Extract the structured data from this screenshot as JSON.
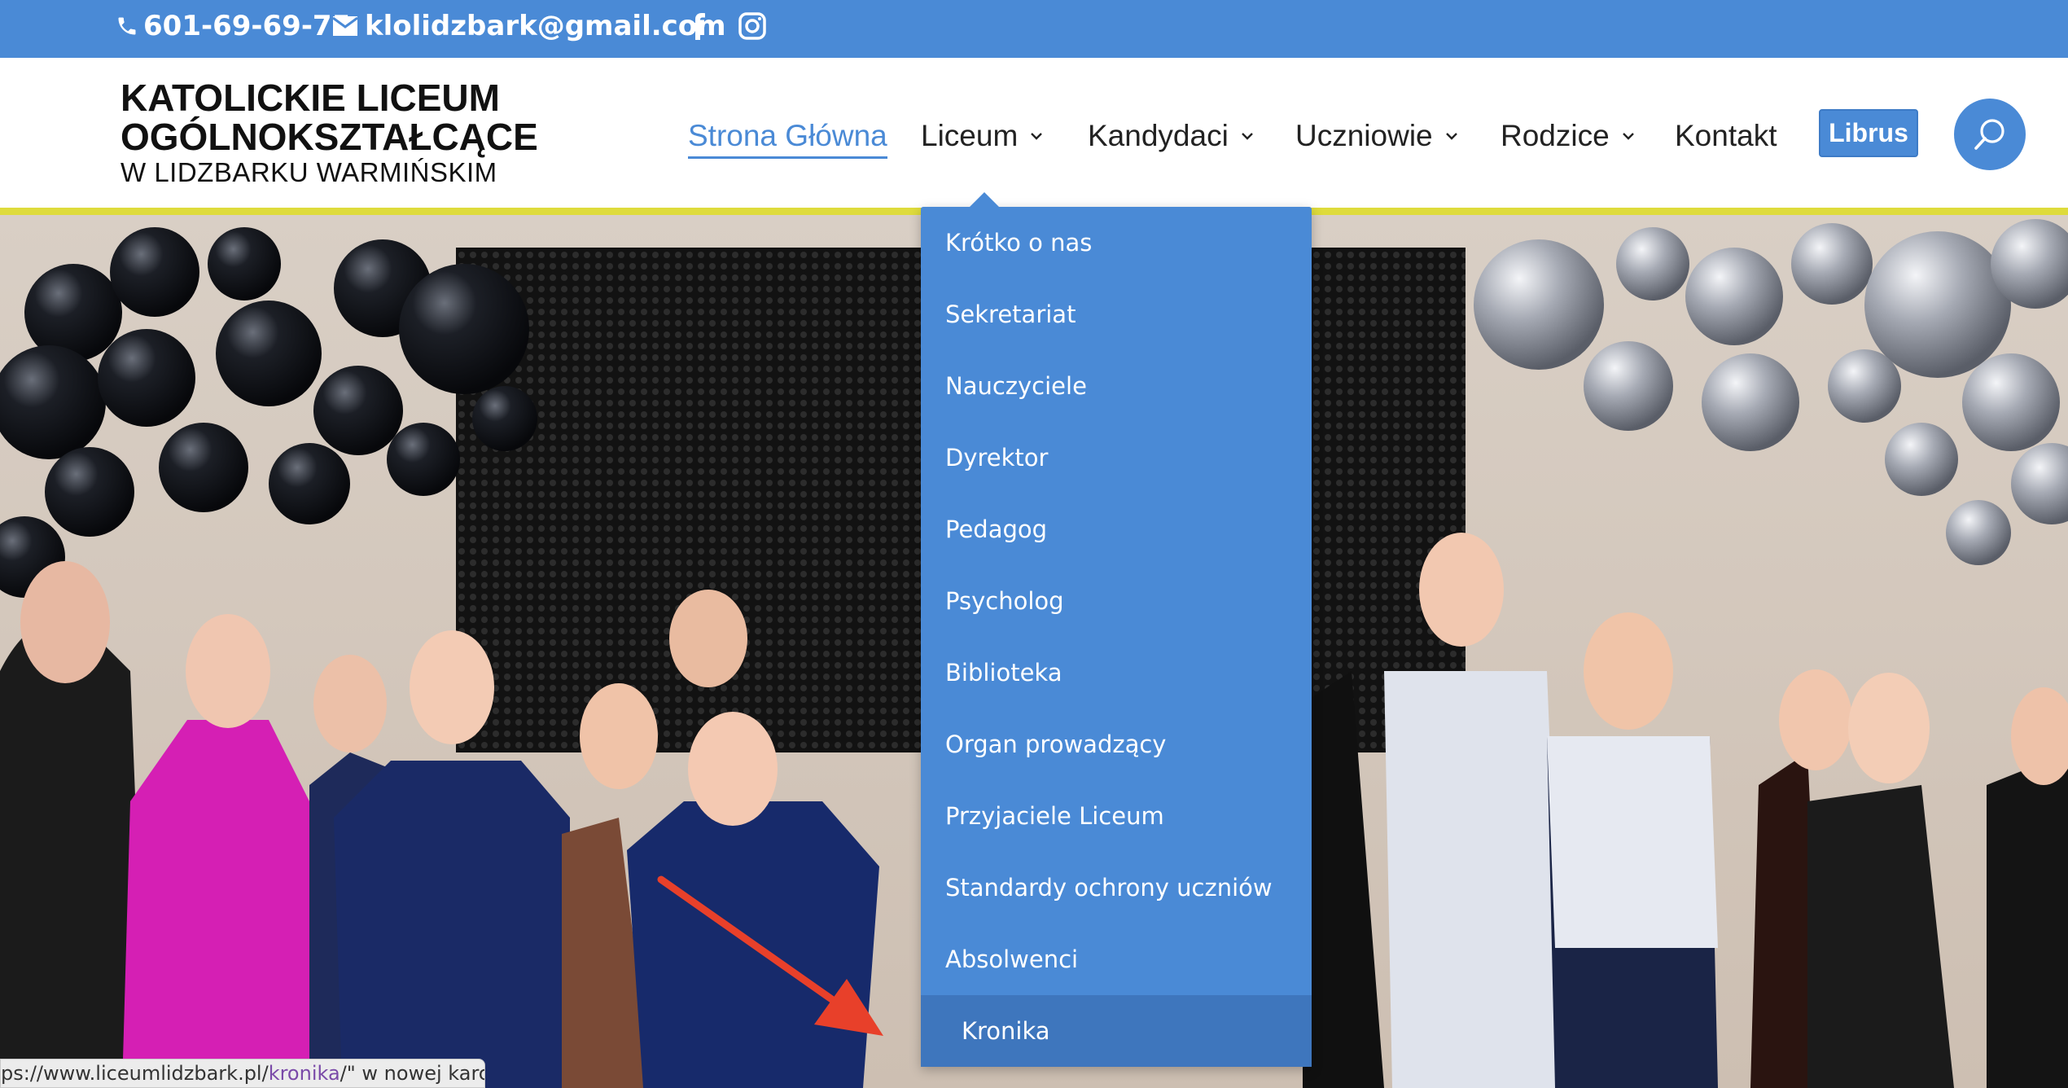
{
  "topbar": {
    "phone": "601-69-69-75",
    "email": "klolidzbark@gmail.com",
    "icons": [
      "phone-icon",
      "envelope-icon",
      "facebook-icon",
      "instagram-icon"
    ]
  },
  "logo": {
    "line1": "KATOLICKIE LICEUM",
    "line2": "OGÓLNOKSZTAŁCĄCE",
    "line3": "W LIDZBARKU WARMIŃSKIM"
  },
  "nav": {
    "items": [
      {
        "label": "Strona Główna",
        "active": true,
        "has_dropdown": false
      },
      {
        "label": "Liceum",
        "active": false,
        "has_dropdown": true
      },
      {
        "label": "Kandydaci",
        "active": false,
        "has_dropdown": true
      },
      {
        "label": "Uczniowie",
        "active": false,
        "has_dropdown": true
      },
      {
        "label": "Rodzice",
        "active": false,
        "has_dropdown": true
      },
      {
        "label": "Kontakt",
        "active": false,
        "has_dropdown": false
      }
    ],
    "librus_label": "Librus"
  },
  "dropdown": {
    "items": [
      "Krótko o nas",
      "Sekretariat",
      "Nauczyciele",
      "Dyrektor",
      "Pedagog",
      "Psycholog",
      "Biblioteka",
      "Organ prowadzący",
      "Przyjaciele Liceum",
      "Standardy ochrony uczniów",
      "Absolwenci",
      "Kronika"
    ],
    "hovered": "Kronika"
  },
  "statusbar": {
    "prefix": "ps://www.liceumlidzbark.pl/",
    "highlight": "kronika",
    "suffix": "/\" w nowej karcie"
  },
  "colors": {
    "brand_blue": "#4a8ad6",
    "hover_blue": "#3e76bd",
    "accent_yellow": "#dedb3c",
    "annotation_arrow": "#e8402a"
  }
}
